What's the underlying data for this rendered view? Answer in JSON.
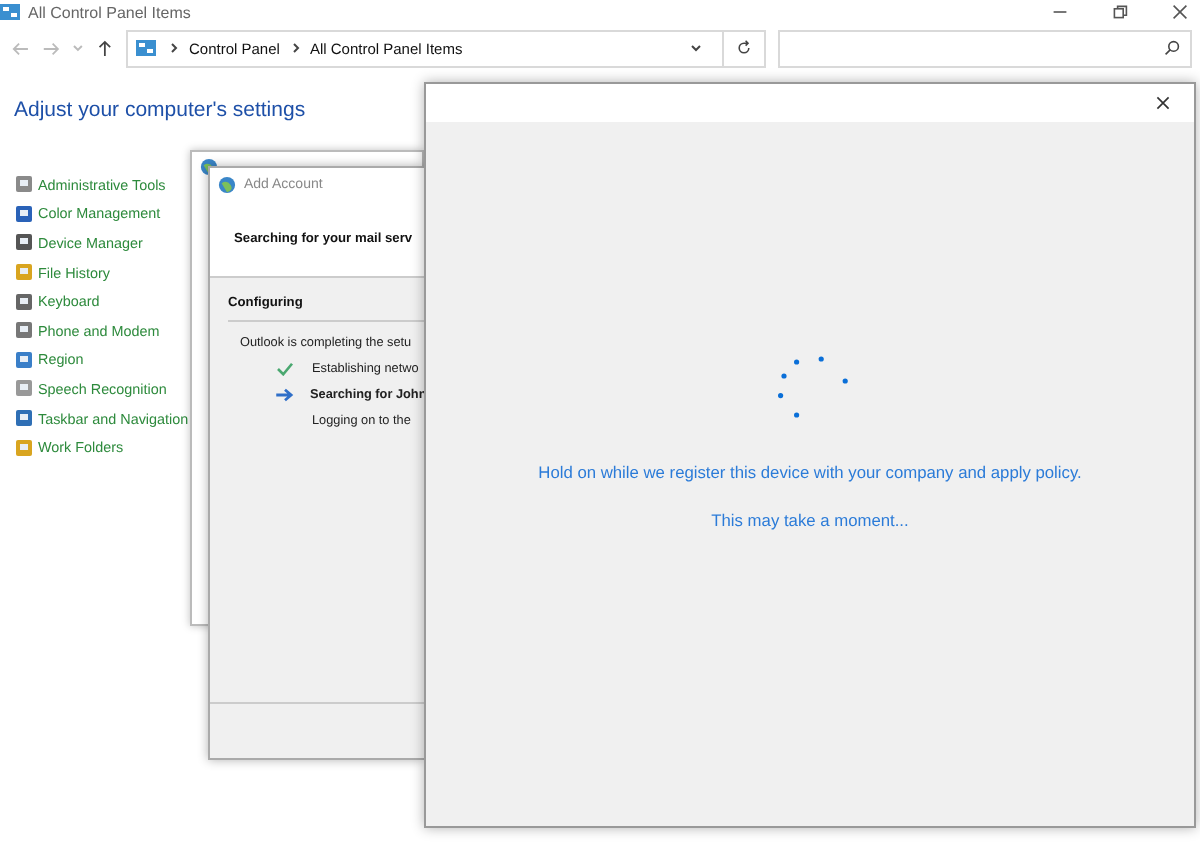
{
  "window": {
    "title": "All Control Panel Items"
  },
  "address_bar": {
    "path": [
      "Control Panel",
      "All Control Panel Items"
    ]
  },
  "heading": "Adjust your computer's settings",
  "items": [
    {
      "label": "Administrative Tools"
    },
    {
      "label": "Color Management"
    },
    {
      "label": "Device Manager"
    },
    {
      "label": "File History"
    },
    {
      "label": "Keyboard"
    },
    {
      "label": "Phone and Modem"
    },
    {
      "label": "Region"
    },
    {
      "label": "Speech Recognition"
    },
    {
      "label": "Taskbar and Navigation"
    },
    {
      "label": "Work Folders"
    }
  ],
  "add_account": {
    "title": "Add Account",
    "header": "Searching for your mail serv",
    "section": "Configuring",
    "intro": "Outlook is completing the setu",
    "steps": [
      {
        "label": "Establishing netwo",
        "done": true,
        "current": false
      },
      {
        "label": "Searching for John",
        "done": false,
        "current": true
      },
      {
        "label": "Logging on to the",
        "done": false,
        "current": false
      }
    ]
  },
  "dialog": {
    "message": "Hold on while we register this device with your company and apply policy.",
    "note": "This may take a moment..."
  }
}
